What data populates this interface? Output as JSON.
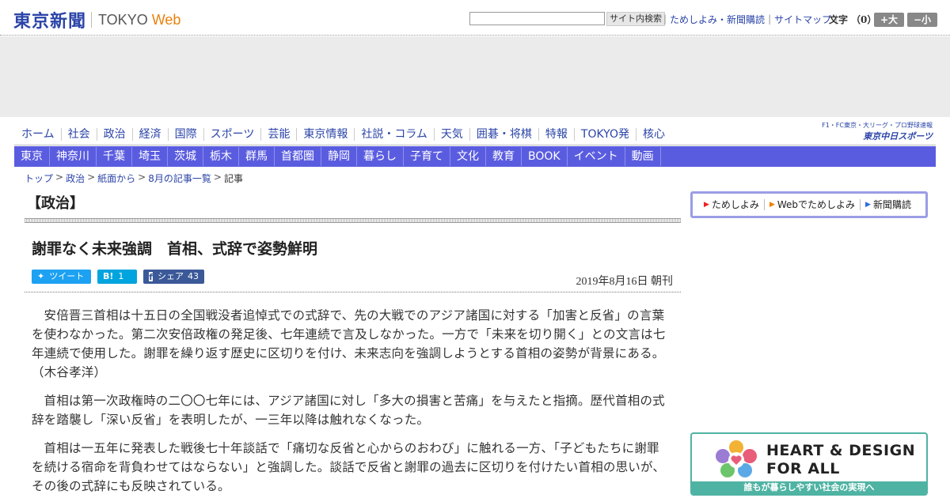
{
  "header": {
    "logo_jp": "東京新聞",
    "logo_tokyo": "TOKYO",
    "logo_web": "Web",
    "search_placeholder": "",
    "search_button": "サイト内検索",
    "links": [
      "ためしよみ・新聞購読",
      "サイトマップ"
    ],
    "fontsize_label": "文字",
    "fontsize_count": "（0）",
    "fontsize_big": "+大",
    "fontsize_small": "−小"
  },
  "nav_primary": [
    "ホーム",
    "社会",
    "政治",
    "経済",
    "国際",
    "スポーツ",
    "芸能",
    "東京情報",
    "社説・コラム",
    "天気",
    "囲碁・将棋",
    "特報",
    "TOKYO発",
    "核心"
  ],
  "chunichi": {
    "sub": "F1・FC東京・大リーグ・プロ野球速報",
    "main": "東京中日スポーツ"
  },
  "nav_secondary": [
    "東京",
    "神奈川",
    "千葉",
    "埼玉",
    "茨城",
    "栃木",
    "群馬",
    "首都圏",
    "静岡",
    "暮らし",
    "子育て",
    "文化",
    "教育",
    "BOOK",
    "イベント",
    "動画"
  ],
  "breadcrumb": {
    "links": [
      "トップ",
      "政治",
      "紙面から",
      "8月の記事一覧"
    ],
    "current": "記事"
  },
  "section_title": "【政治】",
  "article": {
    "headline": "謝罪なく未来強調　首相、式辞で姿勢鮮明",
    "share": {
      "tweet_label": "ツイート",
      "hatena_count": "1",
      "fb_label": "シェア",
      "fb_count": "43"
    },
    "date": "2019年8月16日 朝刊",
    "paragraphs": [
      "安倍晋三首相は十五日の全国戦没者追悼式での式辞で、先の大戦でのアジア諸国に対する「加害と反省」の言葉を使わなかった。第二次安倍政権の発足後、七年連続で言及しなかった。一方で「未来を切り開く」との文言は七年連続で使用した。謝罪を繰り返す歴史に区切りを付け、未来志向を強調しようとする首相の姿勢が背景にある。　（木谷孝洋）",
      "首相は第一次政権時の二〇〇七年には、アジア諸国に対し「多大の損害と苦痛」を与えたと指摘。歴代首相の式辞を踏襲し「深い反省」を表明したが、一三年以降は触れなくなった。",
      "首相は一五年に発表した戦後七十年談話で「痛切な反省と心からのおわび」に触れる一方、「子どもたちに謝罪を続ける宿命を背負わせてはならない」と強調した。談話で反省と謝罪の過去に区切りを付けたい首相の思いが、その後の式辞にも反映されている。"
    ]
  },
  "subscribe": [
    "ためしよみ",
    "Webでためしよみ",
    "新聞購読"
  ],
  "banner": {
    "title_line1": "HEART & DESIGN",
    "title_line2": "FOR ALL",
    "footer": "誰もが暮らしやすい社会の実現へ"
  },
  "colors": {
    "brand_blue": "#2b44a8",
    "nav_band": "#5a5ce0",
    "web_orange": "#e8820c",
    "banner_teal": "#4fb3a3"
  }
}
